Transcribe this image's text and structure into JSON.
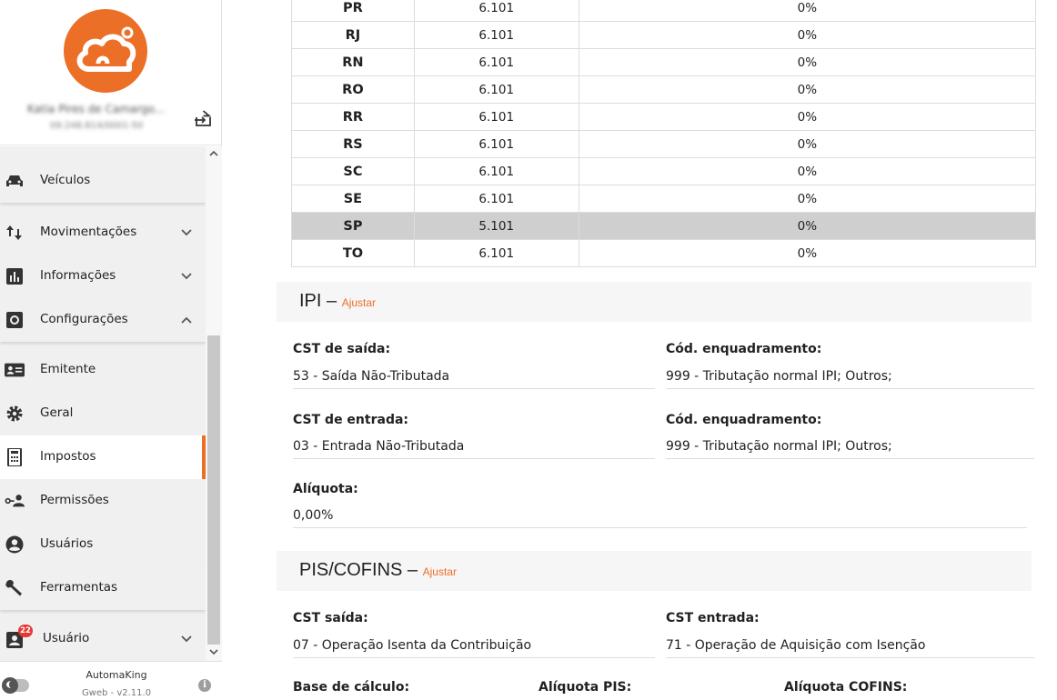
{
  "sidebar": {
    "user_name": "Katia Pires de Camargo...",
    "user_doc": "09.248.814/0001-50",
    "menu": [
      {
        "label": "Veículos",
        "icon": "car-icon"
      },
      {
        "label": "Movimentações",
        "icon": "arrows-updown-icon"
      },
      {
        "label": "Informações",
        "icon": "chart-icon"
      },
      {
        "label": "Configurações",
        "icon": "settings-icon"
      },
      {
        "label": "Emitente",
        "icon": "id-card-icon"
      },
      {
        "label": "Geral",
        "icon": "gear-icon"
      },
      {
        "label": "Impostos",
        "icon": "calculator-icon"
      },
      {
        "label": "Permissões",
        "icon": "key-user-icon"
      },
      {
        "label": "Usuários",
        "icon": "account-circle-icon"
      },
      {
        "label": "Ferramentas",
        "icon": "wrench-icon"
      },
      {
        "label": "Usuário",
        "icon": "user-badge-icon",
        "badge": "22"
      }
    ],
    "footer": {
      "app_name": "AutomaKing",
      "version": "Gweb - v2.11.0"
    }
  },
  "uf_table": {
    "rows": [
      {
        "uf": "PR",
        "cfop": "6.101",
        "aliquota": "0%"
      },
      {
        "uf": "RJ",
        "cfop": "6.101",
        "aliquota": "0%"
      },
      {
        "uf": "RN",
        "cfop": "6.101",
        "aliquota": "0%"
      },
      {
        "uf": "RO",
        "cfop": "6.101",
        "aliquota": "0%"
      },
      {
        "uf": "RR",
        "cfop": "6.101",
        "aliquota": "0%"
      },
      {
        "uf": "RS",
        "cfop": "6.101",
        "aliquota": "0%"
      },
      {
        "uf": "SC",
        "cfop": "6.101",
        "aliquota": "0%"
      },
      {
        "uf": "SE",
        "cfop": "6.101",
        "aliquota": "0%"
      },
      {
        "uf": "SP",
        "cfop": "5.101",
        "aliquota": "0%"
      },
      {
        "uf": "TO",
        "cfop": "6.101",
        "aliquota": "0%"
      }
    ]
  },
  "ipi": {
    "title": "IPI",
    "adjust_link": "Ajustar",
    "cst_saida_label": "CST de saída:",
    "cst_saida_value": "53 - Saída Não-Tributada",
    "enq_saida_label": "Cód. enquadramento:",
    "enq_saida_value": "999 - Tributação normal IPI; Outros;",
    "cst_entrada_label": "CST de entrada:",
    "cst_entrada_value": "03 - Entrada Não-Tributada",
    "enq_entrada_label": "Cód. enquadramento:",
    "enq_entrada_value": "999 - Tributação normal IPI; Outros;",
    "aliquota_label": "Alíquota:",
    "aliquota_value": "0,00%"
  },
  "pis_cofins": {
    "title": "PIS/COFINS",
    "adjust_link": "Ajustar",
    "cst_saida_label": "CST saída:",
    "cst_saida_value": "07 - Operação Isenta da Contribuição",
    "cst_entrada_label": "CST entrada:",
    "cst_entrada_value": "71 - Operação de Aquisição com Isenção",
    "base_label": "Base de cálculo:",
    "aliq_pis_label": "Alíquota PIS:",
    "aliq_cofins_label": "Alíquota COFINS:"
  },
  "colors": {
    "accent": "#ec6f27",
    "highlight_row": "#cfcfcf"
  }
}
